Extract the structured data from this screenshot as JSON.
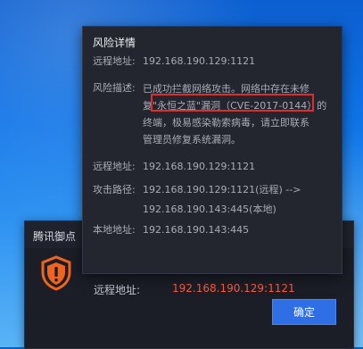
{
  "alert": {
    "title": "腾讯御点",
    "remote_label": "远程地址:",
    "remote_value": "192.168.190.129:1121",
    "confirm_label": "确定",
    "shield_glyph": "!"
  },
  "detail": {
    "title": "风险详情",
    "remote_label_1": "远程地址:",
    "remote_value_1": "192.168.190.129:1121",
    "desc_label": "风险描述:",
    "desc_line_1": "已成功拦截网络攻击。网络中存在未修",
    "desc_line_2": "复\"永恒之蓝\"漏洞（CVE-2017-0144）的",
    "desc_line_3": "终端，极易感染勒索病毒，请立即联系",
    "desc_line_4": "管理员修复系统漏洞。",
    "remote_label_2": "远程地址:",
    "remote_value_2": "192.168.190.129:1121",
    "path_label": "攻击路径:",
    "path_line_1": "192.168.190.129:1121(远程) -->",
    "path_line_2": "192.168.190.143:445(本地)",
    "local_label": "本地地址:",
    "local_value": "192.168.190.143:445"
  },
  "colors": {
    "highlight_box": "#e22b2b",
    "alert_value": "#ff5a3c",
    "button": "#2f6fe6",
    "shield": "#f0641e"
  }
}
